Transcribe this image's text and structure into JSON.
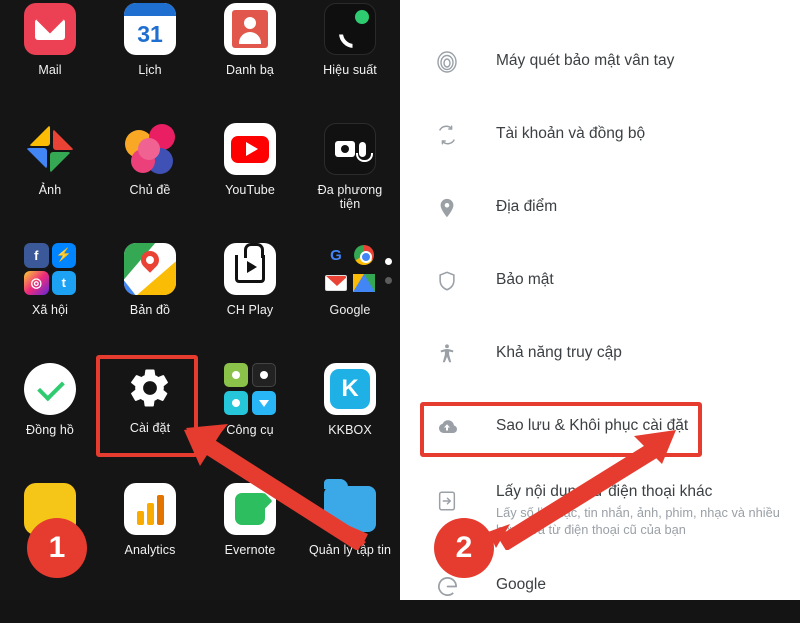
{
  "drawer": {
    "apps": [
      {
        "label": "Mail",
        "icon": "mail-icon"
      },
      {
        "label": "Lịch",
        "icon": "calendar-icon",
        "value": "31"
      },
      {
        "label": "Danh bạ",
        "icon": "contacts-icon"
      },
      {
        "label": "Hiệu suất",
        "icon": "phone-productivity-icon"
      },
      {
        "label": "Ảnh",
        "icon": "google-photos-icon"
      },
      {
        "label": "Chủ đề",
        "icon": "themes-icon"
      },
      {
        "label": "YouTube",
        "icon": "youtube-icon"
      },
      {
        "label": "Đa phương tiện",
        "icon": "multimedia-folder-icon"
      },
      {
        "label": "Xã hội",
        "icon": "social-folder-icon"
      },
      {
        "label": "Bản đồ",
        "icon": "google-maps-icon"
      },
      {
        "label": "CH Play",
        "icon": "play-store-icon"
      },
      {
        "label": "Google",
        "icon": "google-folder-icon"
      },
      {
        "label": "Đồng hồ",
        "icon": "clock-icon"
      },
      {
        "label": "Cài đặt",
        "icon": "settings-gear-icon"
      },
      {
        "label": "Công cụ",
        "icon": "tools-folder-icon"
      },
      {
        "label": "KKBOX",
        "icon": "kkbox-icon",
        "value": "K"
      },
      {
        "label": "",
        "icon": "yellow-app-icon"
      },
      {
        "label": "Analytics",
        "icon": "google-analytics-icon"
      },
      {
        "label": "Evernote",
        "icon": "evernote-icon"
      },
      {
        "label": "Quản lý tập tin",
        "icon": "file-manager-icon"
      }
    ]
  },
  "settings": {
    "rows": [
      {
        "title": "Máy quét bảo mật vân tay",
        "sub": "",
        "icon": "fingerprint-icon"
      },
      {
        "title": "Tài khoản và đồng bộ",
        "sub": "",
        "icon": "sync-icon"
      },
      {
        "title": "Địa điểm",
        "sub": "",
        "icon": "location-pin-icon"
      },
      {
        "title": "Bảo mật",
        "sub": "",
        "icon": "shield-icon"
      },
      {
        "title": "Khả năng truy cập",
        "sub": "",
        "icon": "accessibility-icon"
      },
      {
        "title": "Sao lưu & Khôi phục cài đặt",
        "sub": "",
        "icon": "cloud-backup-icon"
      },
      {
        "title": "Lấy nội dung từ điện thoại khác",
        "sub": "Lấy số liên lạc, tin nhắn, ảnh, phim, nhạc và nhiều hơn nữa từ điện thoại cũ của bạn",
        "icon": "transfer-device-icon"
      },
      {
        "title": "Google",
        "sub": "",
        "icon": "google-g-icon"
      }
    ]
  },
  "annotations": {
    "steps": [
      "1",
      "2"
    ],
    "accent_color": "#e63c2f"
  }
}
